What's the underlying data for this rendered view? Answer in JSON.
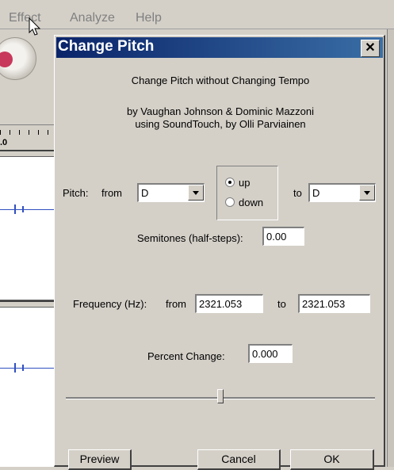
{
  "menubar": {
    "items": [
      "Effect",
      "Analyze",
      "Help"
    ]
  },
  "background": {
    "ruler_label": ".0"
  },
  "dialog": {
    "title": "Change Pitch",
    "close_glyph": "✕",
    "heading": "Change Pitch without Changing Tempo",
    "credits_line1": "by Vaughan Johnson & Dominic Mazzoni",
    "credits_line2": "using SoundTouch, by Olli Parviainen",
    "pitch": {
      "label": "Pitch:",
      "from_label": "from",
      "from_value": "D",
      "to_label": "to",
      "to_value": "D",
      "direction_options": [
        "up",
        "down"
      ],
      "direction_selected": "up"
    },
    "semitones": {
      "label": "Semitones (half-steps):",
      "value": "0.00"
    },
    "frequency": {
      "label": "Frequency (Hz):",
      "from_label": "from",
      "from_value": "2321.053",
      "to_label": "to",
      "to_value": "2321.053"
    },
    "percent_change": {
      "label": "Percent Change:",
      "value": "0.000",
      "slider_level": 0.5
    },
    "buttons": {
      "preview": "Preview",
      "cancel": "Cancel",
      "ok": "OK"
    }
  }
}
